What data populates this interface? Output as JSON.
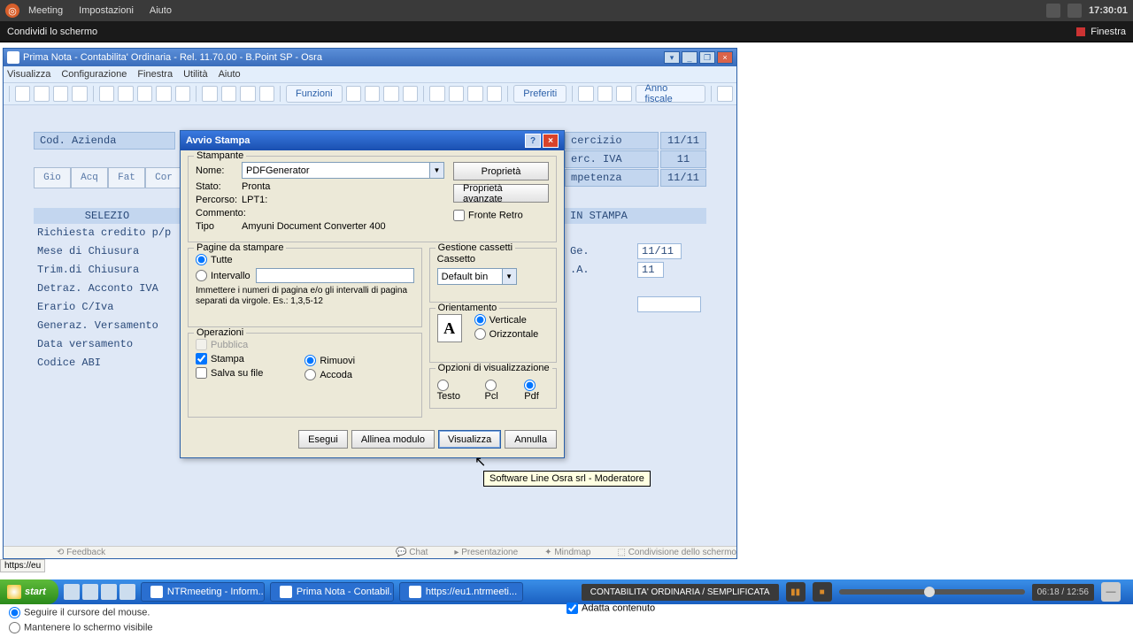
{
  "topbar": {
    "menu": [
      "Meeting",
      "Impostazioni",
      "Aiuto"
    ],
    "clock": "17:30:01"
  },
  "sharebar": {
    "title": "Condividi lo schermo",
    "finestra": "Finestra"
  },
  "appwin": {
    "title": "Prima Nota - Contabilita' Ordinaria - Rel. 11.70.00 - B.Point SP - Osra",
    "menu": [
      "Visualizza",
      "Configurazione",
      "Finestra",
      "Utilità",
      "Aiuto"
    ],
    "toolbar": {
      "funzioni": "Funzioni",
      "preferiti": "Preferiti",
      "anno": "Anno fiscale"
    }
  },
  "bg": {
    "codAzienda": "Cod. Azienda",
    "tabs": [
      "Gio",
      "Acq",
      "Fat",
      "Cor"
    ],
    "hdr1": "SELEZIO",
    "hdr2": "IN STAMPA",
    "left": [
      "Richiesta credito p/p",
      "Mese di Chiusura",
      "Trim.di Chiusura",
      "Detraz. Acconto IVA",
      "Erario C/Iva",
      "Generaz. Versamento",
      "Data versamento",
      "Codice ABI"
    ],
    "rightLabels": [
      "cercizio",
      "erc. IVA",
      "mpetenza",
      "Ge.",
      ".A."
    ],
    "rightVals": [
      "11/11",
      "11",
      "11/11",
      "11/11",
      "11"
    ]
  },
  "dialog": {
    "title": "Avvio Stampa",
    "stampante": {
      "grp": "Stampante",
      "nome": "Nome:",
      "nomeVal": "PDFGenerator",
      "stato": "Stato:",
      "statoVal": "Pronta",
      "percorso": "Percorso:",
      "percorsoVal": "LPT1:",
      "commento": "Commento:",
      "tipo": "Tipo",
      "tipoVal": "Amyuni Document Converter 400",
      "proprieta": "Proprietà",
      "propAvanz": "Proprietà avanzate",
      "fronteRetro": "Fronte Retro"
    },
    "pagine": {
      "grp": "Pagine da stampare",
      "tutte": "Tutte",
      "intervallo": "Intervallo",
      "hint": "Immettere i numeri di pagina e/o gli intervalli di pagina separati da virgole. Es.: 1,3,5-12"
    },
    "operazioni": {
      "grp": "Operazioni",
      "pubblica": "Pubblica",
      "stampa": "Stampa",
      "salva": "Salva su file",
      "rimuovi": "Rimuovi",
      "accoda": "Accoda"
    },
    "cassetti": {
      "grp": "Gestione cassetti",
      "cassetto": "Cassetto",
      "val": "Default bin"
    },
    "orient": {
      "grp": "Orientamento",
      "vert": "Verticale",
      "oriz": "Orizzontale"
    },
    "opz": {
      "grp": "Opzioni di visualizzazione",
      "testo": "Testo",
      "pcl": "Pcl",
      "pdf": "Pdf"
    },
    "btns": {
      "esegui": "Esegui",
      "allinea": "Allinea modulo",
      "visualizza": "Visualizza",
      "annulla": "Annulla"
    },
    "tooltip": "Software Line Osra srl - Moderatore"
  },
  "taskbar": {
    "start": "start",
    "tasks": [
      "NTRmeeting - Inform...",
      "Prima Nota - Contabil...",
      "https://eu1.ntrmeeti..."
    ]
  },
  "url": "https://eu",
  "player": {
    "badge": "CONTABILITA' ORDINARIA / SEMPLIFICATA",
    "time": "06:18 / 12:56"
  },
  "bottom": {
    "r1": "Seguire il cursore del mouse.",
    "r2": "Mantenere lo schermo visibile",
    "chk": "Adatta contenuto"
  },
  "stripItems": [
    "Feedback",
    "Chat",
    "Presentazione",
    "Mindmap",
    "Condivisione dello schermo"
  ]
}
